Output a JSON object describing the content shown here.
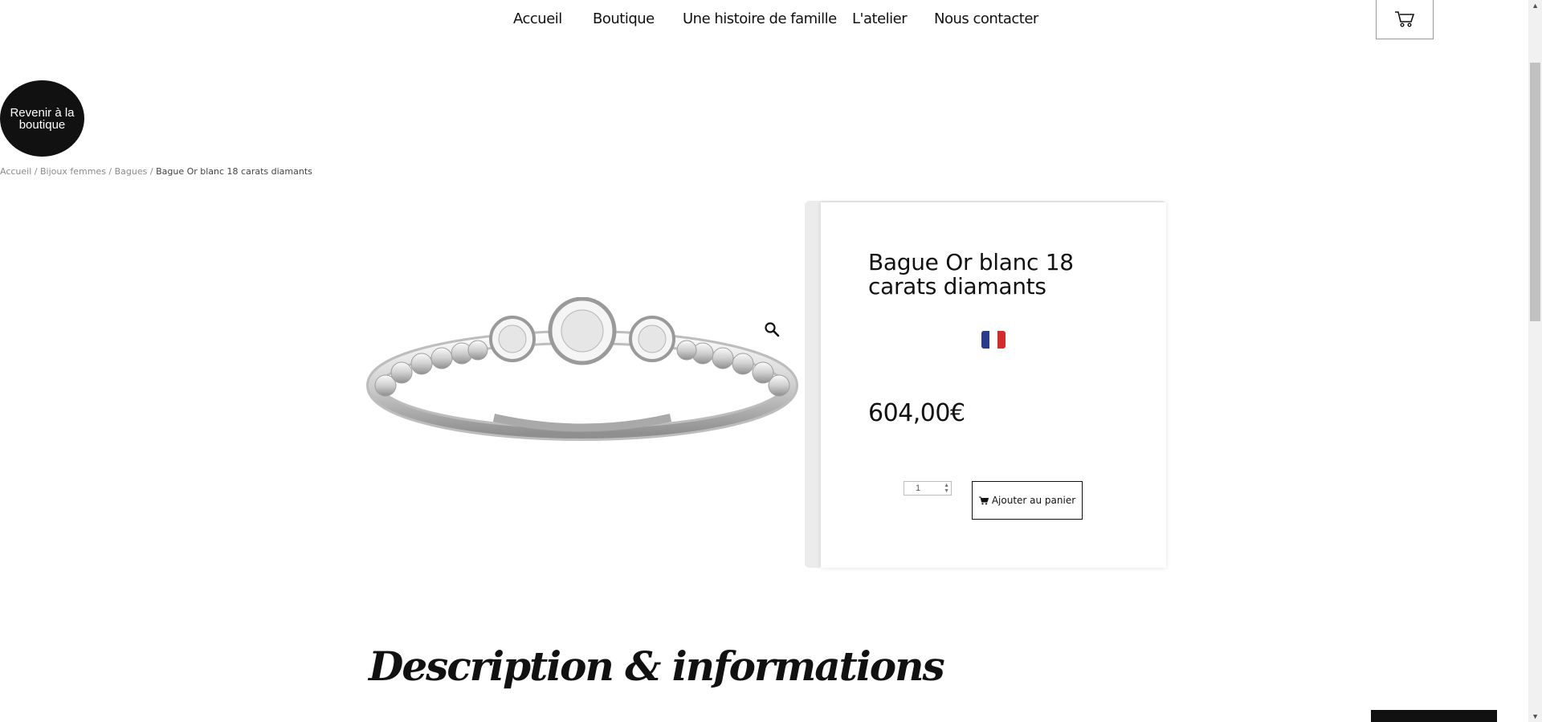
{
  "nav": {
    "items": [
      "Accueil",
      "Boutique",
      "Une histoire de famille",
      "L'atelier",
      "Nous contacter"
    ]
  },
  "back_button": "Revenir à la boutique",
  "breadcrumb": {
    "items": [
      "Accueil",
      "Bijoux femmes",
      "Bagues"
    ],
    "separator": " / ",
    "current": "Bague Or blanc 18 carats diamants"
  },
  "product": {
    "title": "Bague Or blanc 18 carats diamants",
    "price": "604,00€",
    "quantity": "1",
    "add_to_cart_label": "Ajouter au panier",
    "flag_colors": [
      "#2b3a8c",
      "#ffffff",
      "#d62b2b"
    ]
  },
  "section": {
    "title": "Description & informations"
  },
  "icons": {
    "cart": "cart-icon",
    "zoom": "magnifier-icon",
    "add_cart": "cart-icon"
  }
}
